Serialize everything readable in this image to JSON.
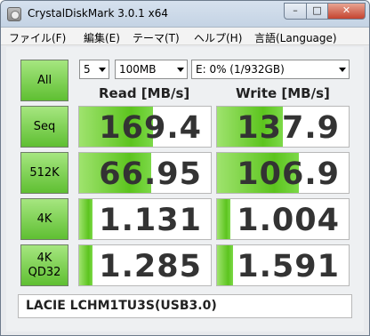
{
  "window": {
    "title": "CrystalDiskMark 3.0.1 x64",
    "min_label": "–",
    "max_label": "□",
    "close_label": "✕"
  },
  "menu": [
    {
      "label": "ファイル(F)"
    },
    {
      "label": "編集(E)"
    },
    {
      "label": "テーマ(T)"
    },
    {
      "label": "ヘルプ(H)"
    },
    {
      "label": "言語(Language)"
    }
  ],
  "controls": {
    "all_label": "All",
    "count": "5",
    "size": "100MB",
    "drive": "E: 0% (1/932GB)"
  },
  "headers": {
    "read": "Read [MB/s]",
    "write": "Write [MB/s]"
  },
  "tests": [
    {
      "label": "Seq",
      "read": "169.4",
      "write": "137.9",
      "read_level": 0.56,
      "write_level": 0.5
    },
    {
      "label": "512K",
      "read": "66.95",
      "write": "106.9",
      "read_level": 0.55,
      "write_level": 0.62
    },
    {
      "label": "4K",
      "read": "1.131",
      "write": "1.004",
      "read_level": 0.1,
      "write_level": 0.1
    },
    {
      "label": "4K\nQD32",
      "read": "1.285",
      "write": "1.591",
      "read_level": 0.1,
      "write_level": 0.12
    }
  ],
  "comment": "LACIE  LCHM1TU3S(USB3.0)",
  "colors": {
    "accent_green": "#5fbf32",
    "bar_green": "#5cc41e"
  }
}
